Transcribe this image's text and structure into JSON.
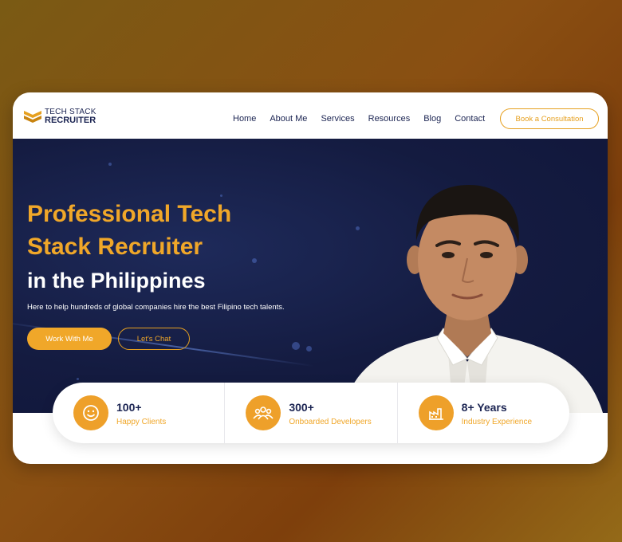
{
  "brand": {
    "line1": "TECH STACK",
    "line2": "RECRUITER",
    "colors": {
      "navy": "#1b2452",
      "gold": "#f0a729",
      "hero_bg": "#141b40"
    }
  },
  "nav": {
    "items": [
      {
        "label": "Home"
      },
      {
        "label": "About Me"
      },
      {
        "label": "Services"
      },
      {
        "label": "Resources"
      },
      {
        "label": "Blog"
      },
      {
        "label": "Contact"
      }
    ],
    "cta_label": "Book a Consultation"
  },
  "hero": {
    "title_line1": "Professional Tech",
    "title_line2": "Stack Recruiter",
    "title_line3": "in the Philippines",
    "subtitle": "Here to help hundreds of global companies hire the best Filipino tech talents.",
    "primary_button": "Work With Me",
    "secondary_button": "Let's Chat"
  },
  "stats": [
    {
      "value": "100+",
      "label": "Happy Clients",
      "icon": "smile-icon"
    },
    {
      "value": "300+",
      "label": "Onboarded Developers",
      "icon": "team-icon"
    },
    {
      "value": "8+ Years",
      "label": "Industry Experience",
      "icon": "industry-icon"
    }
  ]
}
